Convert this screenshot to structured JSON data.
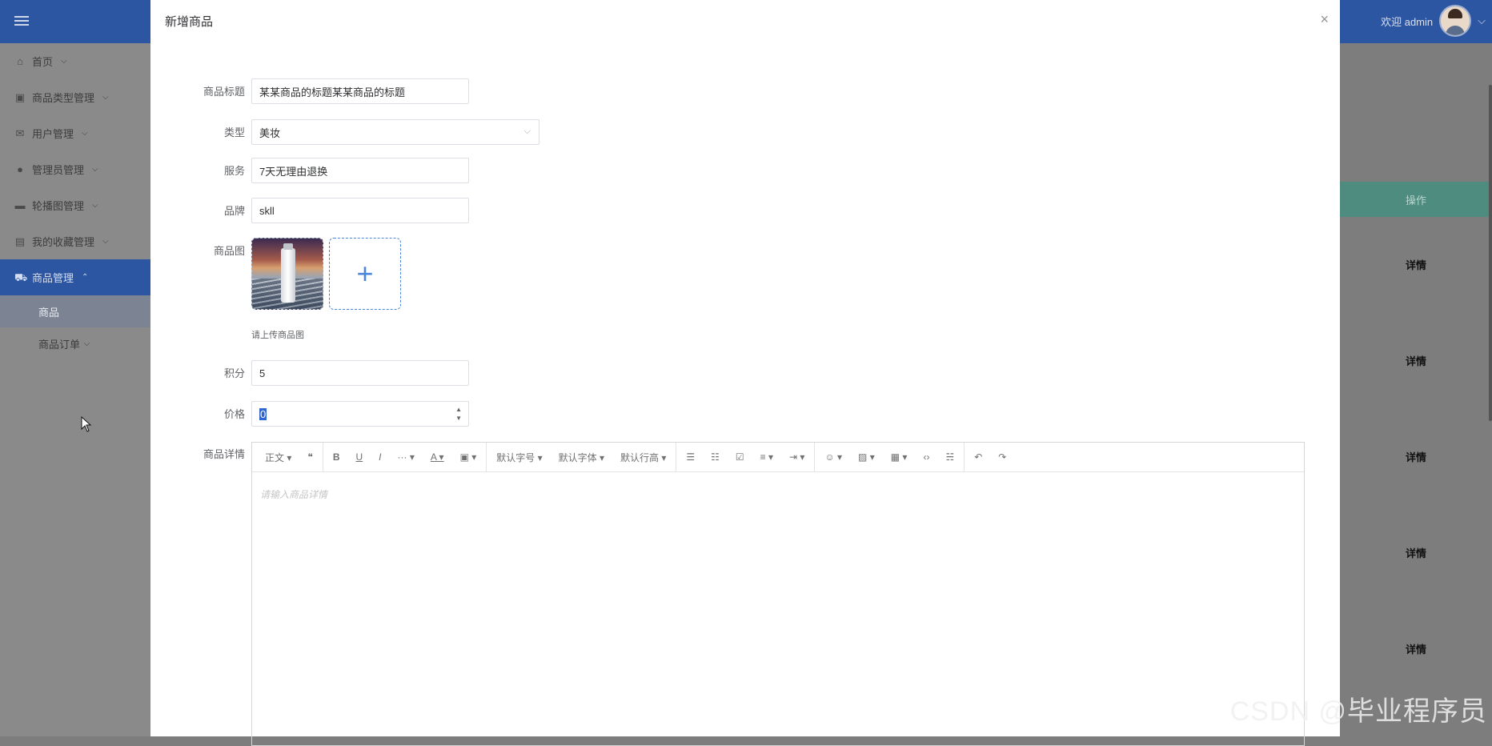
{
  "header": {
    "welcome": "欢迎 admin",
    "caret": "⌵"
  },
  "sidebar": {
    "items": [
      {
        "label": "首页",
        "icon": "home-icon",
        "glyph": "⌂"
      },
      {
        "label": "商品类型管理",
        "icon": "category-icon",
        "glyph": "▣"
      },
      {
        "label": "用户管理",
        "icon": "mail-icon",
        "glyph": "✉"
      },
      {
        "label": "管理员管理",
        "icon": "mouse-icon",
        "glyph": "●"
      },
      {
        "label": "轮播图管理",
        "icon": "picture-icon",
        "glyph": "▬"
      },
      {
        "label": "我的收藏管理",
        "icon": "box-icon",
        "glyph": "▤"
      },
      {
        "label": "商品管理",
        "icon": "car-icon",
        "glyph": "⛟"
      }
    ],
    "subitems": [
      {
        "label": "商品"
      },
      {
        "label": "商品订单"
      }
    ]
  },
  "table": {
    "operation_header": "操作",
    "detail_label": "详情"
  },
  "dialog": {
    "title": "新增商品",
    "close": "×",
    "form": {
      "title_label": "商品标题",
      "title_value": "某某商品的标题某某商品的标题",
      "type_label": "类型",
      "type_value": "美妆",
      "service_label": "服务",
      "service_value": "7天无理由退换",
      "brand_label": "品牌",
      "brand_value": "skll",
      "image_label": "商品图",
      "image_tip": "请上传商品图",
      "upload_plus": "+",
      "points_label": "积分",
      "points_value": "5",
      "price_label": "价格",
      "price_value": "0",
      "detail_label": "商品详情"
    },
    "editor": {
      "toolbar": {
        "paragraph": "正文 ▾",
        "quote": "❝",
        "bold": "B",
        "underline": "U",
        "italic": "I",
        "more": "··· ▾",
        "font_color": "A ▾",
        "bg_color": "▣ ▾",
        "font_size": "默认字号 ▾",
        "font_family": "默认字体 ▾",
        "line_height": "默认行高 ▾",
        "bullet_list": "☰",
        "ordered_list": "☷",
        "todo": "☑",
        "align": "≡ ▾",
        "indent": "⇥ ▾",
        "emoji": "☺ ▾",
        "image": "▨ ▾",
        "table": "▦ ▾",
        "code": "‹›",
        "divider": "☵",
        "undo": "↶",
        "redo": "↷"
      },
      "placeholder": "请输入商品详情"
    }
  },
  "watermark": "CSDN @毕业程序员"
}
